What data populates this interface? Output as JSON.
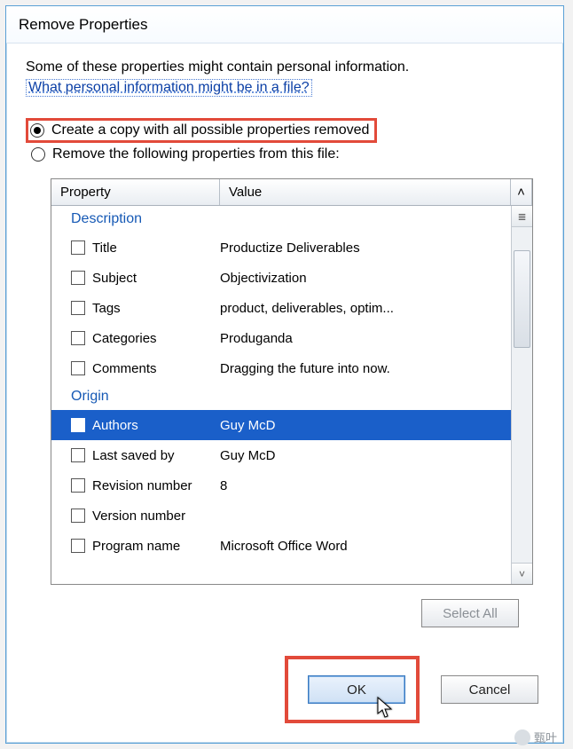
{
  "title": "Remove Properties",
  "intro": "Some of these properties might contain personal information.",
  "link": "What personal information might be in a file?",
  "options": {
    "create_copy": "Create a copy with all possible properties removed",
    "remove_following": "Remove the following properties from this file:"
  },
  "headers": {
    "property": "Property",
    "value": "Value",
    "scroll_up": "˄"
  },
  "groups": {
    "description": "Description",
    "origin": "Origin"
  },
  "rows": {
    "title": {
      "name": "Title",
      "value": "Productize Deliverables"
    },
    "subject": {
      "name": "Subject",
      "value": "Objectivization"
    },
    "tags": {
      "name": "Tags",
      "value": "product, deliverables, optim..."
    },
    "categories": {
      "name": "Categories",
      "value": "Produganda"
    },
    "comments": {
      "name": "Comments",
      "value": "Dragging the future into now."
    },
    "authors": {
      "name": "Authors",
      "value": "Guy McD"
    },
    "last_saved": {
      "name": "Last saved by",
      "value": "Guy McD"
    },
    "revision": {
      "name": "Revision number",
      "value": "8"
    },
    "version": {
      "name": "Version number",
      "value": ""
    },
    "program": {
      "name": "Program name",
      "value": "Microsoft Office Word"
    }
  },
  "buttons": {
    "select_all": "Select All",
    "ok": "OK",
    "cancel": "Cancel"
  },
  "watermark": "甄叶"
}
